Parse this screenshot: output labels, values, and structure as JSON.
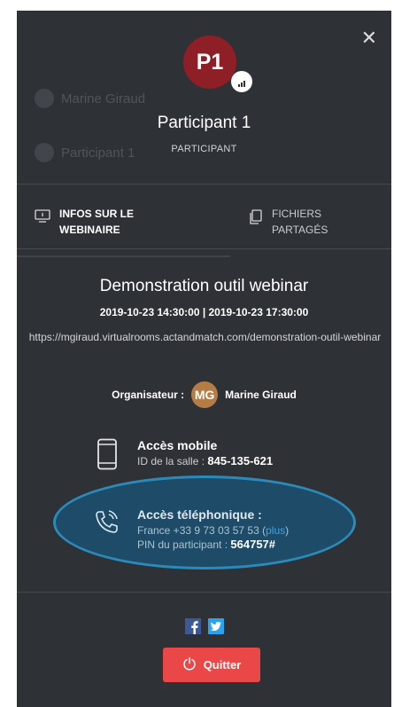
{
  "window": {
    "close_icon": "close-icon"
  },
  "background_list": {
    "rows": [
      "Marine Giraud",
      "Participant 1"
    ]
  },
  "participant": {
    "initials": "P1",
    "name": "Participant 1",
    "role": "PARTICIPANT",
    "avatar_color": "#8e1f26",
    "badge_icon": "signal-bars-icon"
  },
  "tabs": [
    {
      "label": "INFOS SUR LE\nWEBINAIRE",
      "icon": "info-screen-icon",
      "active": true
    },
    {
      "label": "FICHIERS\nPARTAGÉS",
      "icon": "files-icon",
      "active": false
    }
  ],
  "webinar": {
    "title": "Demonstration outil webinar",
    "dates": "2019-10-23 14:30:00 | 2019-10-23 17:30:00",
    "url": "https://mgiraud.virtualrooms.actandmatch.com/demonstration-outil-webinar"
  },
  "organizer": {
    "label": "Organisateur :",
    "initials": "MG",
    "name": "Marine Giraud",
    "avatar_color": "#b57d45"
  },
  "mobile_access": {
    "title": "Accès mobile",
    "room_label": "ID de la salle :",
    "room_id": "845-135-621",
    "icon": "smartphone-icon"
  },
  "phone_access": {
    "title": "Accès téléphonique :",
    "number_line": "France +33 9 73 03 57 53",
    "plus_label": "plus",
    "pin_label": "PIN du participant :",
    "pin": "564757#",
    "icon": "phone-ringing-icon"
  },
  "social": {
    "facebook_icon": "facebook-icon",
    "twitter_icon": "twitter-icon"
  },
  "quit_button": {
    "label": "Quitter",
    "icon": "power-icon",
    "color": "#ea4848"
  }
}
